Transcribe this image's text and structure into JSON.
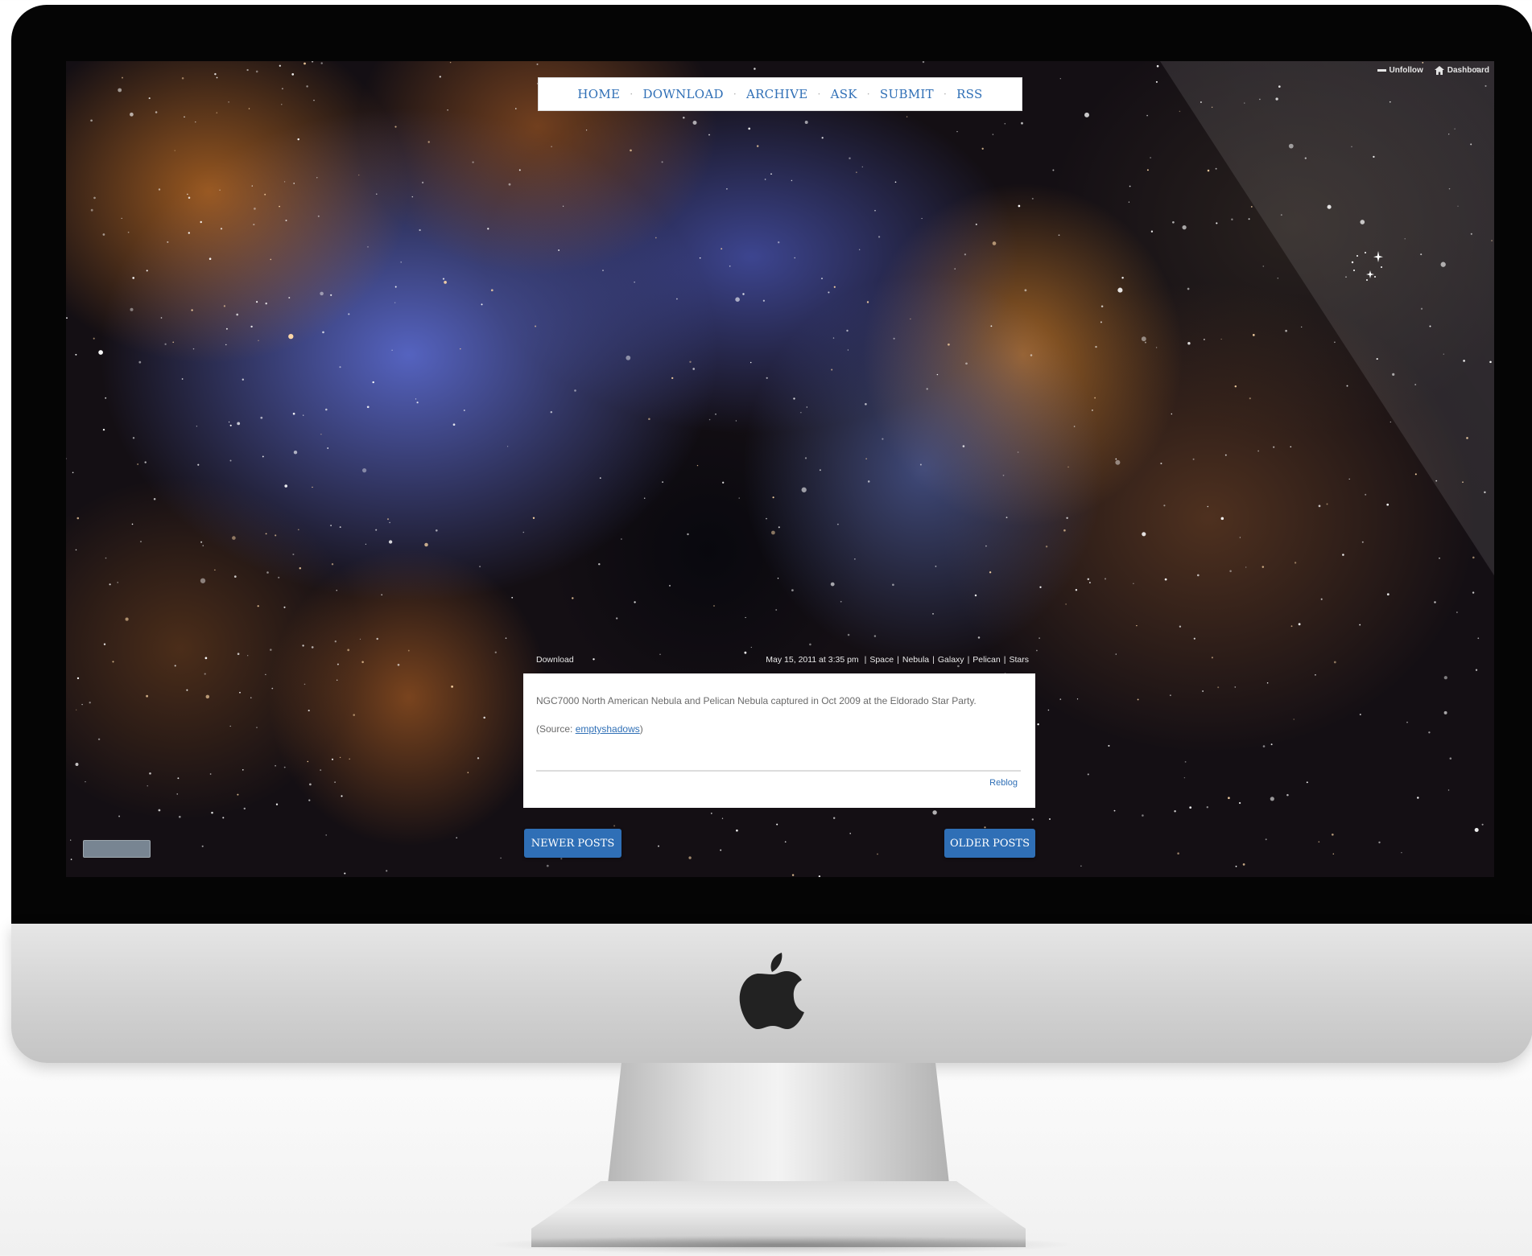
{
  "nav": {
    "items": [
      {
        "label": "HOME"
      },
      {
        "label": "DOWNLOAD"
      },
      {
        "label": "ARCHIVE"
      },
      {
        "label": "ASK"
      },
      {
        "label": "SUBMIT"
      },
      {
        "label": "RSS"
      }
    ],
    "separator": "·"
  },
  "tumblr_controls": {
    "unfollow_label": "Unfollow",
    "dashboard_label": "Dashboard"
  },
  "post": {
    "download_label": "Download",
    "date": "May 15, 2011 at 3:35 pm",
    "tags": [
      "Space",
      "Nebula",
      "Galaxy",
      "Pelican",
      "Stars"
    ],
    "tag_separator": "|",
    "caption": "NGC7000 North American Nebula and Pelican Nebula captured in Oct 2009 at the Eldorado Star Party.",
    "source_prefix": "(Source:",
    "source_link": "emptyshadows",
    "source_suffix": ")",
    "reblog_label": "Reblog"
  },
  "pagination": {
    "newer_label": "NEWER POSTS",
    "older_label": "OLDER POSTS"
  },
  "colors": {
    "link_blue": "#2f6fb6",
    "button_blue": "#2f6fb6",
    "bezel": "#050505",
    "chin_silver": "#d2d2d2"
  },
  "icons": {
    "apple": "apple-logo",
    "unfollow": "minus-icon",
    "dashboard": "home-icon",
    "cursor": "sparkle-cursor-icon"
  }
}
